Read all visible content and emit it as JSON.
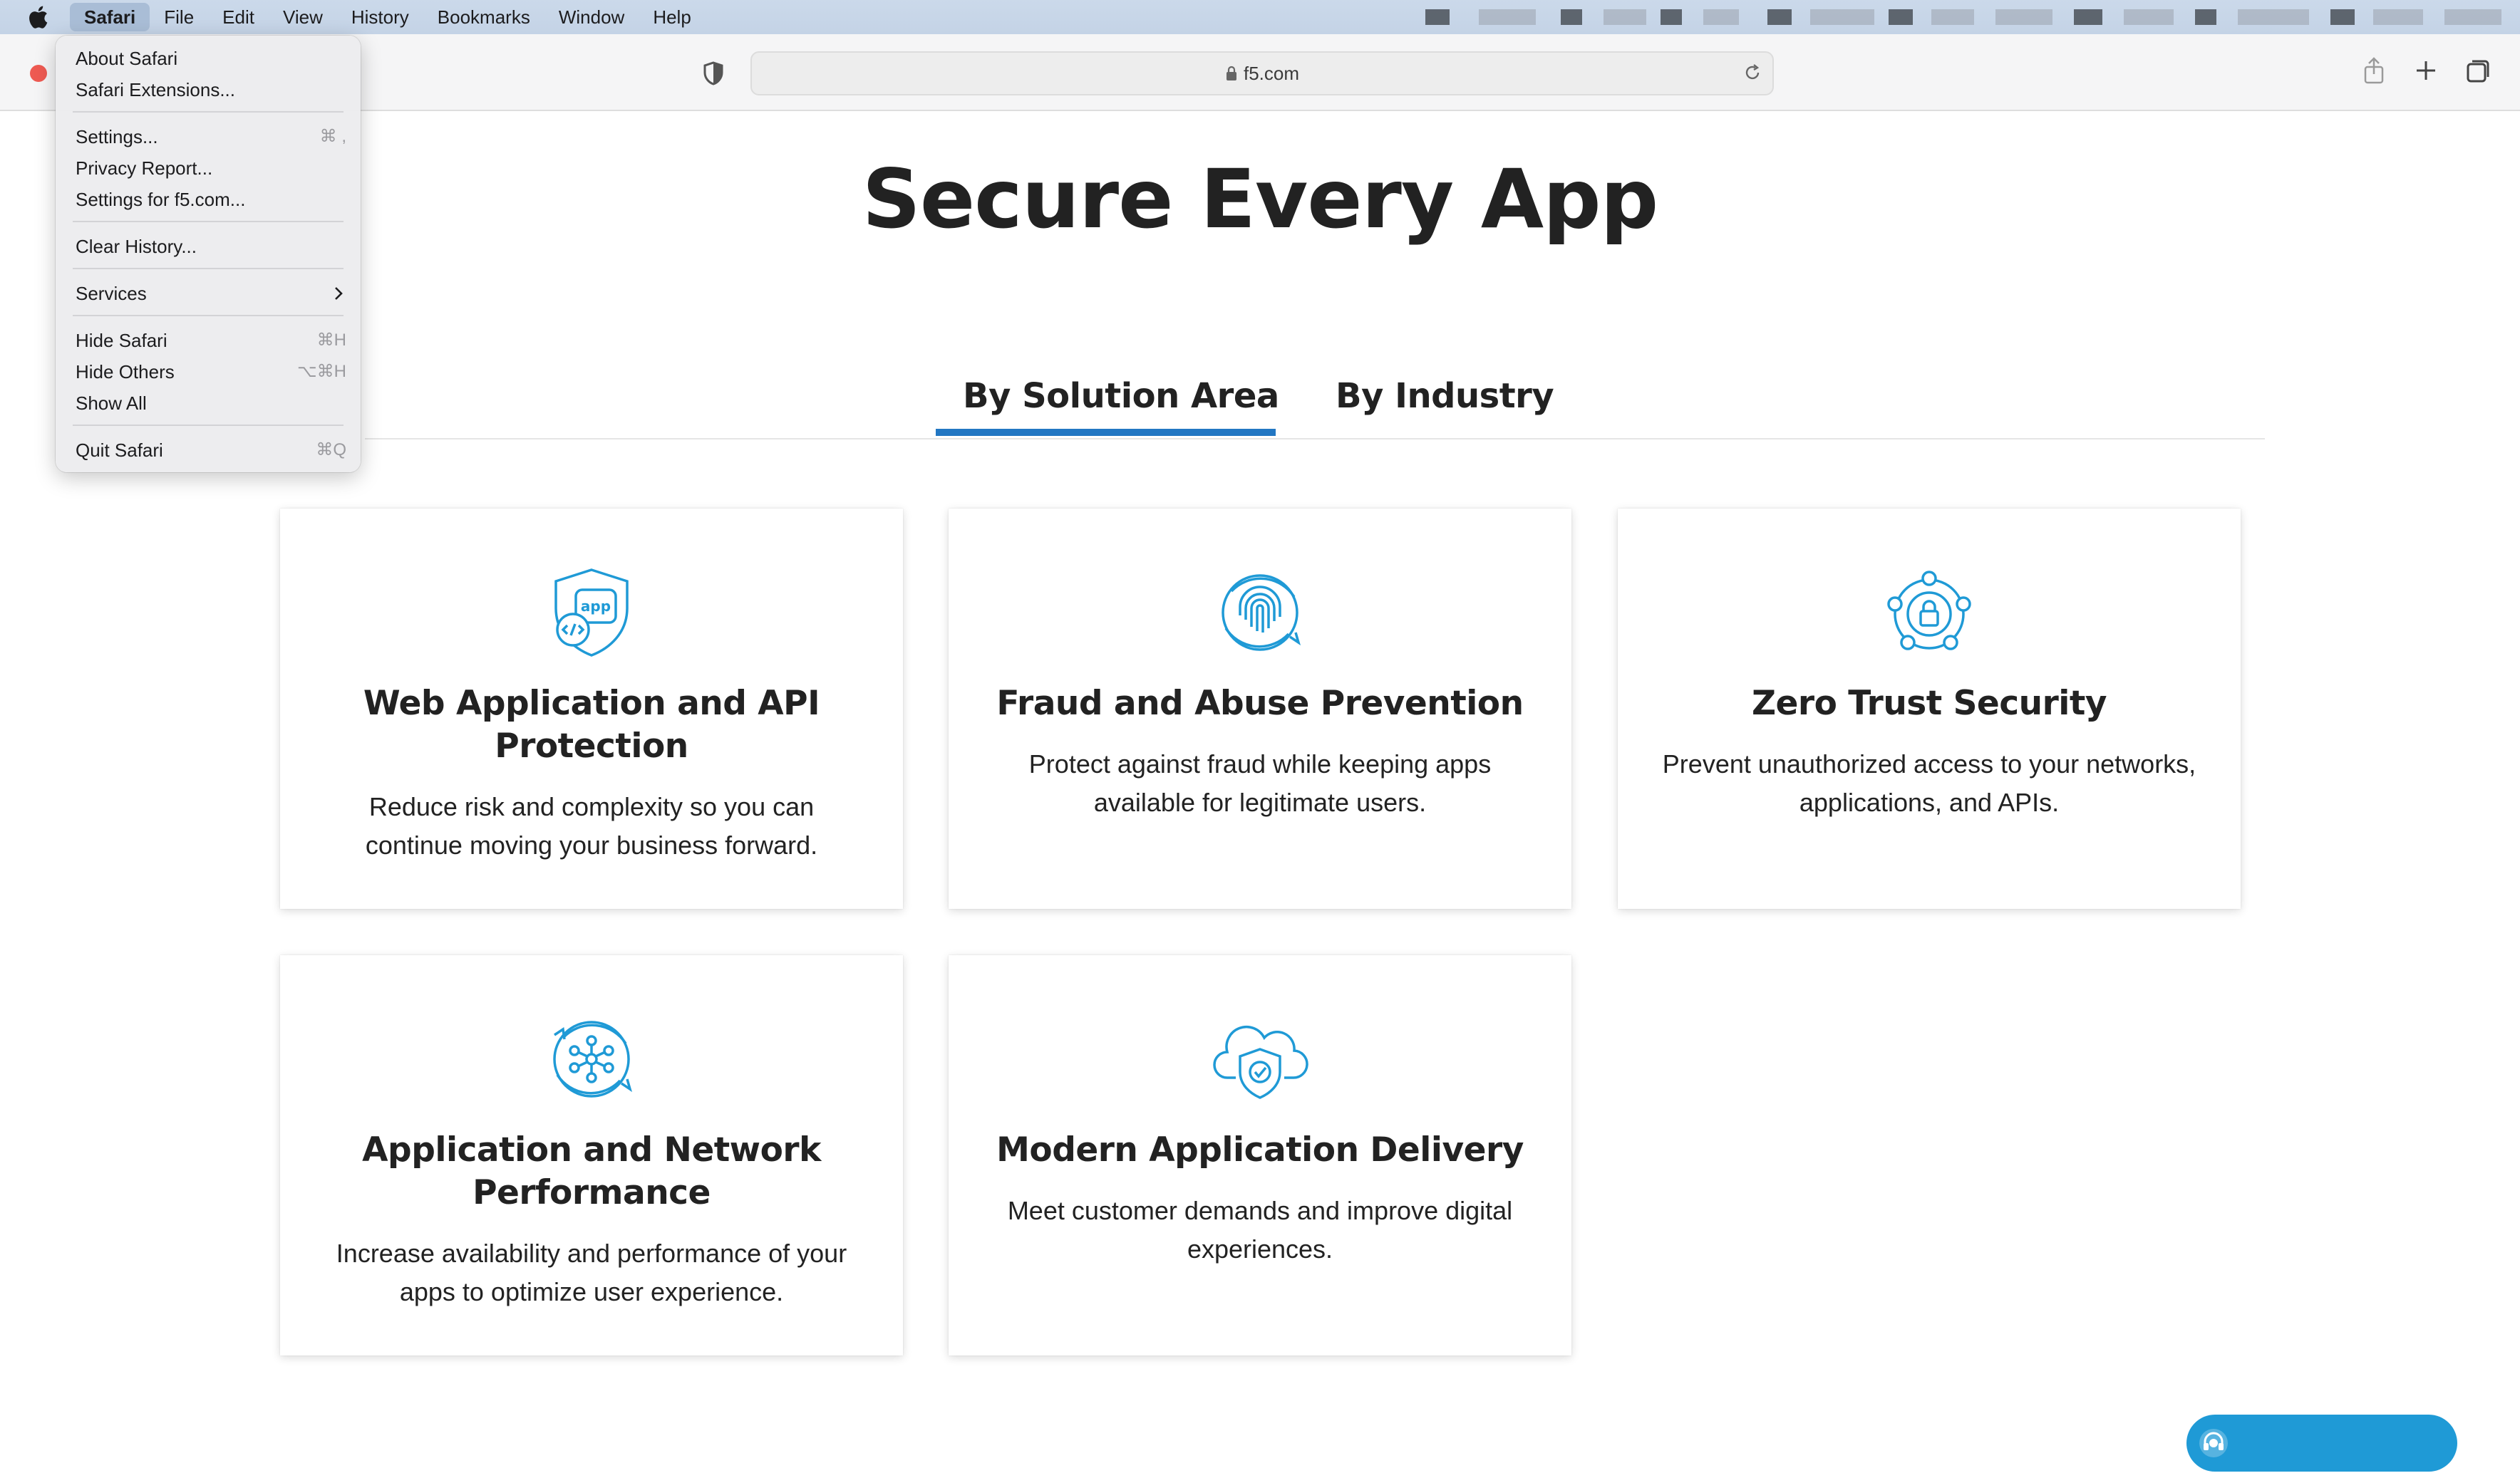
{
  "menubar": {
    "items": [
      {
        "label": "Safari"
      },
      {
        "label": "File"
      },
      {
        "label": "Edit"
      },
      {
        "label": "View"
      },
      {
        "label": "History"
      },
      {
        "label": "Bookmarks"
      },
      {
        "label": "Window"
      },
      {
        "label": "Help"
      }
    ]
  },
  "safari_menu": {
    "items": [
      {
        "label": "About Safari",
        "shortcut": ""
      },
      {
        "label": "Safari Extensions...",
        "shortcut": ""
      },
      {
        "label": "Settings...",
        "shortcut": "⌘ ,"
      },
      {
        "label": "Privacy Report...",
        "shortcut": ""
      },
      {
        "label": "Settings for f5.com...",
        "shortcut": ""
      },
      {
        "label": "Clear History...",
        "shortcut": ""
      },
      {
        "label": "Services",
        "shortcut": ""
      },
      {
        "label": "Hide Safari",
        "shortcut": "⌘H"
      },
      {
        "label": "Hide Others",
        "shortcut": "⌥⌘H"
      },
      {
        "label": "Show All",
        "shortcut": ""
      },
      {
        "label": "Quit Safari",
        "shortcut": "⌘Q"
      }
    ]
  },
  "toolbar": {
    "url": "f5.com"
  },
  "page": {
    "title": "Secure Every App",
    "tabs": [
      {
        "label": "By Solution Area",
        "active": true
      },
      {
        "label": "By Industry",
        "active": false
      }
    ],
    "cards": [
      {
        "icon": "app-shield-icon",
        "title": "Web Application and API Protection",
        "desc": "Reduce risk and complexity so you can continue moving your business forward."
      },
      {
        "icon": "fingerprint-icon",
        "title": "Fraud and Abuse Prevention",
        "desc": "Protect against fraud while keeping apps available for legitimate users."
      },
      {
        "icon": "lock-network-icon",
        "title": "Zero Trust Security",
        "desc": "Prevent unauthorized access to your networks, applications, and APIs."
      },
      {
        "icon": "network-hub-icon",
        "title": "Application and Network Performance",
        "desc": "Increase availability and performance of your apps to optimize user experience."
      },
      {
        "icon": "cloud-shield-icon",
        "title": "Modern Application Delivery",
        "desc": "Meet customer demands and improve digital experiences."
      }
    ]
  },
  "colors": {
    "accent": "#2277c3",
    "icon": "#1f9ad6",
    "text": "#222222"
  }
}
